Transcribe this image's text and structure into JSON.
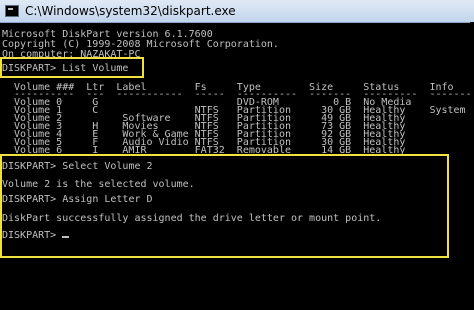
{
  "window": {
    "title": "C:\\Windows\\system32\\diskpart.exe"
  },
  "console": {
    "header": [
      "Microsoft DiskPart version 6.1.7600",
      "Copyright (C) 1999-2008 Microsoft Corporation.",
      "On computer: NAZAKAT-PC"
    ],
    "prompt": "DISKPART> ",
    "cmd_list": "List Volume",
    "table_header": "  Volume ###  Ltr  Label        Fs     Type        Size     Status     Info",
    "table_rule": "  ----------  ---  -----------  -----  ----------  -------  ---------  --------",
    "rows": [
      "  Volume 0     G                       DVD-ROM         0 B  No Media",
      "  Volume 1     C                NTFS   Partition     30 GB  Healthy    System",
      "  Volume 2          Software    NTFS   Partition     49 GB  Healthy",
      "  Volume 3     H    Movies      NTFS   Partition     73 GB  Healthy",
      "  Volume 4     E    Work & Game NTFS   Partition     92 GB  Healthy",
      "  Volume 5     F    Audio Vidio NTFS   Partition     30 GB  Healthy",
      "  Volume 6     I    AMIR        FAT32  Removable     14 GB  Healthy"
    ],
    "cmd_select": "Select Volume 2",
    "msg_select": "Volume 2 is the selected volume.",
    "cmd_assign": "Assign Letter D",
    "msg_assign": "DiskPart successfully assigned the drive letter or mount point.",
    "highlight_color": "#f0e040",
    "text_color": "#c0c0c0"
  }
}
